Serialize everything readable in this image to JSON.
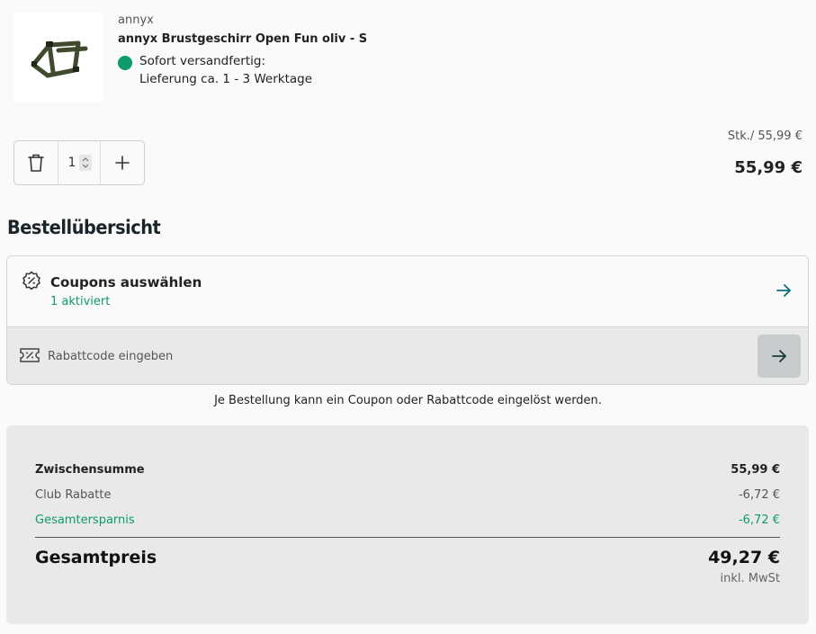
{
  "product": {
    "brand": "annyx",
    "name": "annyx Brustgeschirr Open Fun oliv - S",
    "shipping_status": "Sofort versandfertig:",
    "shipping_time": "Lieferung ca. 1 - 3 Werktage",
    "image_icon": "dog-harness-image"
  },
  "quantity": {
    "value": "1",
    "delete_icon": "trash-icon",
    "plus_icon": "plus-icon"
  },
  "pricing": {
    "unit_price": "Stk./ 55,99 €",
    "line_total": "55,99 €"
  },
  "overview": {
    "title": "Bestellübersicht"
  },
  "coupons": {
    "title": "Coupons auswählen",
    "activated": "1 aktiviert",
    "icon": "coupon-percent-icon"
  },
  "discount_code": {
    "placeholder": "Rabattcode eingeben",
    "icon": "ticket-icon"
  },
  "coupon_note": "Je Bestellung kann ein Coupon oder Rabattcode eingelöst werden.",
  "summary": {
    "subtotal_label": "Zwischensumme",
    "subtotal_value": "55,99 €",
    "club_label": "Club Rabatte",
    "club_value": "-6,72 €",
    "savings_label": "Gesamtersparnis",
    "savings_value": "-6,72 €",
    "total_label": "Gesamtpreis",
    "total_value": "49,27 €",
    "vat_note": "inkl. MwSt"
  },
  "colors": {
    "accent_green": "#0d9a6d",
    "arrow_teal": "#0f6b78",
    "panel_gray": "#e9e9e9"
  }
}
